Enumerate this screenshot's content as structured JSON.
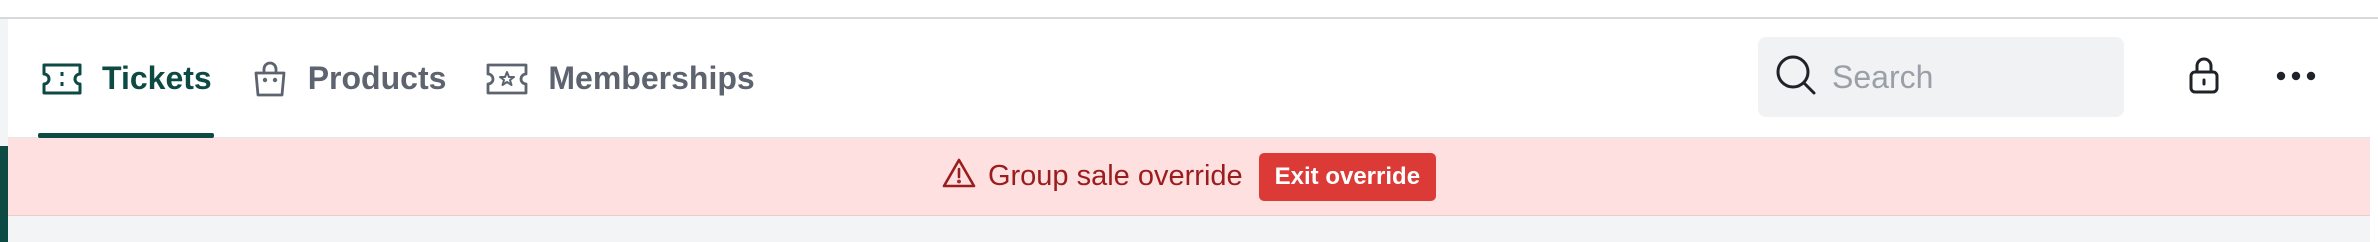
{
  "nav": {
    "tabs": [
      {
        "label": "Tickets",
        "icon": "ticket-icon",
        "active": true
      },
      {
        "label": "Products",
        "icon": "shopping-bag-icon",
        "active": false
      },
      {
        "label": "Memberships",
        "icon": "star-ticket-icon",
        "active": false
      }
    ]
  },
  "search": {
    "placeholder": "Search",
    "icon": "search-icon"
  },
  "toolbar": {
    "lock_icon": "lock-icon",
    "more_icon": "more-horizontal-icon"
  },
  "banner": {
    "icon": "warning-triangle-icon",
    "message": "Group sale override",
    "exit_label": "Exit override"
  },
  "colors": {
    "brand": "#0d4a44",
    "tab_inactive": "#5d6470",
    "banner_bg": "#fde0df",
    "banner_text": "#9b1c1c",
    "danger_button": "#dc3a36"
  }
}
